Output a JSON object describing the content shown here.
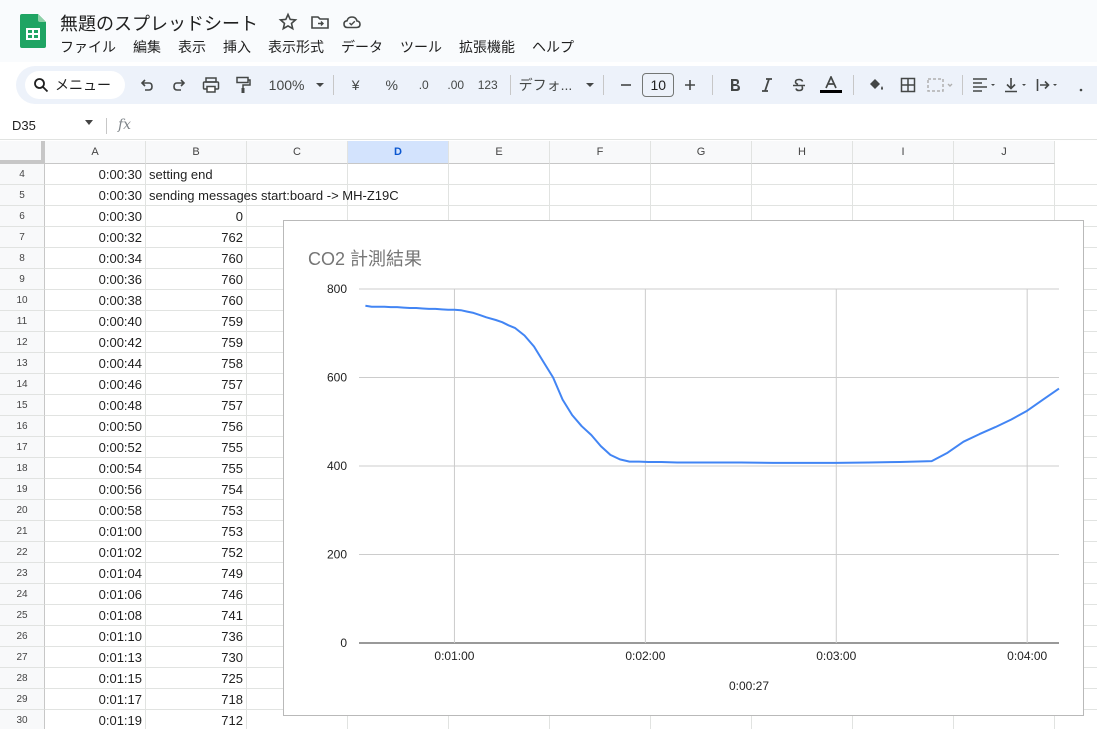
{
  "app": {
    "title": "無題のスプレッドシート",
    "menu": [
      "ファイル",
      "編集",
      "表示",
      "挿入",
      "表示形式",
      "データ",
      "ツール",
      "拡張機能",
      "ヘルプ"
    ]
  },
  "toolbar": {
    "menu_search": "メニュー",
    "zoom": "100%",
    "currency": "¥",
    "percent": "%",
    "dec_decrease": ".0",
    "dec_increase": ".00",
    "number_format": "123",
    "font": "デフォ...",
    "font_size": "10"
  },
  "formula_bar": {
    "name_box": "D35",
    "fx": "fx"
  },
  "columns": [
    "A",
    "B",
    "C",
    "D",
    "E",
    "F",
    "G",
    "H",
    "I",
    "J"
  ],
  "selected_column": "D",
  "rows": [
    {
      "n": "4",
      "a": "0:00:30",
      "b": "setting end",
      "b_type": "text"
    },
    {
      "n": "5",
      "a": "0:00:30",
      "b": "sending messages start:board -> MH-Z19C",
      "b_type": "text"
    },
    {
      "n": "6",
      "a": "0:00:30",
      "b": "0",
      "b_type": "num"
    },
    {
      "n": "7",
      "a": "0:00:32",
      "b": "762",
      "b_type": "num"
    },
    {
      "n": "8",
      "a": "0:00:34",
      "b": "760",
      "b_type": "num"
    },
    {
      "n": "9",
      "a": "0:00:36",
      "b": "760",
      "b_type": "num"
    },
    {
      "n": "10",
      "a": "0:00:38",
      "b": "760",
      "b_type": "num"
    },
    {
      "n": "11",
      "a": "0:00:40",
      "b": "759",
      "b_type": "num"
    },
    {
      "n": "12",
      "a": "0:00:42",
      "b": "759",
      "b_type": "num"
    },
    {
      "n": "13",
      "a": "0:00:44",
      "b": "758",
      "b_type": "num"
    },
    {
      "n": "14",
      "a": "0:00:46",
      "b": "757",
      "b_type": "num"
    },
    {
      "n": "15",
      "a": "0:00:48",
      "b": "757",
      "b_type": "num"
    },
    {
      "n": "16",
      "a": "0:00:50",
      "b": "756",
      "b_type": "num"
    },
    {
      "n": "17",
      "a": "0:00:52",
      "b": "755",
      "b_type": "num"
    },
    {
      "n": "18",
      "a": "0:00:54",
      "b": "755",
      "b_type": "num"
    },
    {
      "n": "19",
      "a": "0:00:56",
      "b": "754",
      "b_type": "num"
    },
    {
      "n": "20",
      "a": "0:00:58",
      "b": "753",
      "b_type": "num"
    },
    {
      "n": "21",
      "a": "0:01:00",
      "b": "753",
      "b_type": "num"
    },
    {
      "n": "22",
      "a": "0:01:02",
      "b": "752",
      "b_type": "num"
    },
    {
      "n": "23",
      "a": "0:01:04",
      "b": "749",
      "b_type": "num"
    },
    {
      "n": "24",
      "a": "0:01:06",
      "b": "746",
      "b_type": "num"
    },
    {
      "n": "25",
      "a": "0:01:08",
      "b": "741",
      "b_type": "num"
    },
    {
      "n": "26",
      "a": "0:01:10",
      "b": "736",
      "b_type": "num"
    },
    {
      "n": "27",
      "a": "0:01:13",
      "b": "730",
      "b_type": "num"
    },
    {
      "n": "28",
      "a": "0:01:15",
      "b": "725",
      "b_type": "num"
    },
    {
      "n": "29",
      "a": "0:01:17",
      "b": "718",
      "b_type": "num"
    },
    {
      "n": "30",
      "a": "0:01:19",
      "b": "712",
      "b_type": "num"
    }
  ],
  "chart_data": {
    "type": "line",
    "title": "CO2 計測結果",
    "xlabel": "0:00:27",
    "ylabel": "",
    "ylim": [
      0,
      800
    ],
    "y_ticks": [
      "0",
      "200",
      "400",
      "600",
      "800"
    ],
    "x_tick_labels": [
      "0:01:00",
      "0:02:00",
      "0:03:00",
      "0:04:00"
    ],
    "x_tick_seconds": [
      60,
      120,
      180,
      240
    ],
    "xlim_seconds": [
      30,
      250
    ],
    "grid": true,
    "line_color": "#4285f4",
    "series": [
      {
        "name": "",
        "x_seconds": [
          32,
          34,
          36,
          38,
          40,
          42,
          44,
          46,
          48,
          50,
          52,
          54,
          56,
          58,
          60,
          62,
          64,
          66,
          68,
          70,
          73,
          75,
          77,
          79,
          82,
          85,
          88,
          91,
          94,
          97,
          100,
          103,
          106,
          109,
          112,
          115,
          118,
          121,
          125,
          130,
          140,
          150,
          160,
          170,
          180,
          190,
          200,
          210,
          215,
          220,
          225,
          230,
          235,
          240,
          245,
          250
        ],
        "values": [
          762,
          760,
          760,
          760,
          759,
          759,
          758,
          757,
          757,
          756,
          755,
          755,
          754,
          753,
          753,
          752,
          749,
          746,
          741,
          736,
          730,
          725,
          718,
          712,
          695,
          670,
          635,
          600,
          550,
          515,
          490,
          470,
          445,
          425,
          415,
          410,
          410,
          409,
          409,
          408,
          408,
          408,
          407,
          407,
          407,
          408,
          409,
          411,
          430,
          455,
          472,
          488,
          505,
          525,
          550,
          575
        ]
      }
    ]
  }
}
